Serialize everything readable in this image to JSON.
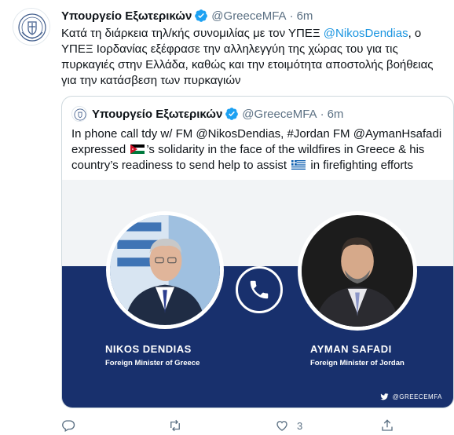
{
  "tweet": {
    "author_name": "Υπουργείο Εξωτερικών",
    "author_handle": "@GreeceMFA",
    "separator": "·",
    "time": "6m",
    "text_before": "Κατά τη διάρκεια τηλ/κής συνομιλίας με τον ΥΠΕΞ ",
    "text_mention": "@NikosDendias",
    "text_after": ", ο ΥΠΕΞ Ιορδανίας εξέφρασε την αλληλεγγύη της χώρας του για τις πυρκαγιές στην Ελλάδα, καθώς και την ετοιμότητα αποστολής βοήθειας για την κατάσβεση των πυρκαγιών"
  },
  "quote": {
    "author_name": "Υπουργείο Εξωτερικών",
    "author_handle": "@GreeceMFA",
    "separator": "·",
    "time": "6m",
    "text_1": "In phone call tdy w/ FM @NikosDendias, #Jordan FM @AymanHsafadi expressed ",
    "text_2": "’s solidarity in the face of the wildfires in Greece & his country’s readiness to send help to assist ",
    "text_3": " in firefighting efforts"
  },
  "card": {
    "left_name": "NIKOS DENDIAS",
    "left_title": "Foreign Minister of Greece",
    "right_name": "AYMAN SAFADI",
    "right_title": "Foreign Minister of Jordan",
    "handle": "@GREECEMFA",
    "band_color": "#18306d"
  },
  "actions": {
    "like_count": "3"
  },
  "icons": {
    "verified": "verified-badge-icon",
    "reply": "reply-icon",
    "retweet": "retweet-icon",
    "like": "heart-icon",
    "share": "share-icon",
    "phone": "phone-icon",
    "twitter": "twitter-bird-icon"
  },
  "colors": {
    "accent": "#1b95e0",
    "muted": "#5b7083"
  }
}
